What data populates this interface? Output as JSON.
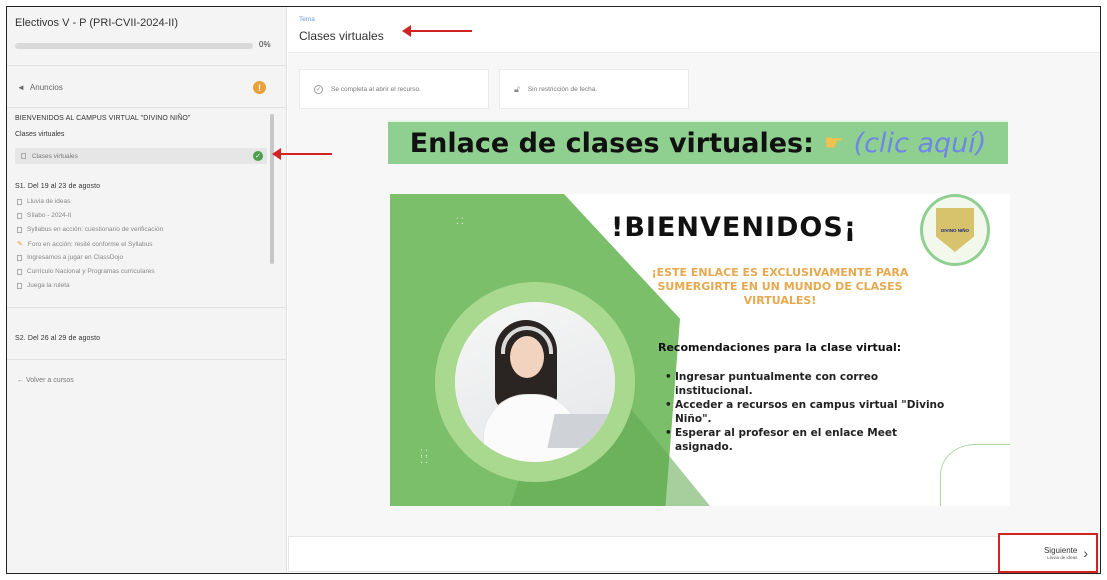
{
  "sidebar": {
    "course_title": "Electivos V - P (PRI-CVII-2024-II)",
    "progress": {
      "percent": 0,
      "label": "0%"
    },
    "announcements_label": "Anuncios",
    "announcements_badge": "!",
    "section_welcome": "BIENVENIDOS AL CAMPUS VIRTUAL \"DIVINO NIÑO\"",
    "subsection_label": "Clases virtuales",
    "active_item_label": "Clases virtuales",
    "week1": {
      "title": "S1. Del 19 al 23 de agosto",
      "items": [
        "Lluvia de ideas",
        "Sílabo - 2024-II",
        "Syllabus en acción: cuestionario de verificación",
        "Foro en acción: resité conforme el Syllabus",
        "Ingresamos a jugar en ClassDojo",
        "Currículo Nacional y Programas curriculares",
        "Juega la ruleta"
      ]
    },
    "week2_title": "S2. Del 26 al 29 de agosto",
    "back_label": "Volver a cursos"
  },
  "main": {
    "breadcrumb": "Tema",
    "page_title": "Clases virtuales",
    "info_completion": "Se completa al abrir el recurso.",
    "info_date": "Sin restricción de fecha."
  },
  "banner": {
    "text": "Enlace de clases virtuales:",
    "click": "(clic aquí)"
  },
  "poster": {
    "title": "!BIENVENIDOS¡",
    "subtitle": "¡ESTE ENLACE ES  EXCLUSIVAMENTE PARA SUMERGIRTE EN UN MUNDO DE CLASES VIRTUALES!",
    "logo_text": "DIVINO NIÑO",
    "rec_title": "Recomendaciones para la clase virtual:",
    "recs": [
      "Ingresar puntualmente con correo institucional.",
      "Acceder a recursos en  campus virtual \"Divino Niño\".",
      "Esperar al profesor en el enlace Meet asignado."
    ]
  },
  "nav": {
    "next_label": "Siguiente",
    "next_sub": "Lluvia de ideas"
  },
  "colors": {
    "accent_green": "#4f9d4f",
    "banner_green": "#8fcf8f",
    "annotation_red": "#d32222",
    "badge_orange": "#e8a23a"
  }
}
